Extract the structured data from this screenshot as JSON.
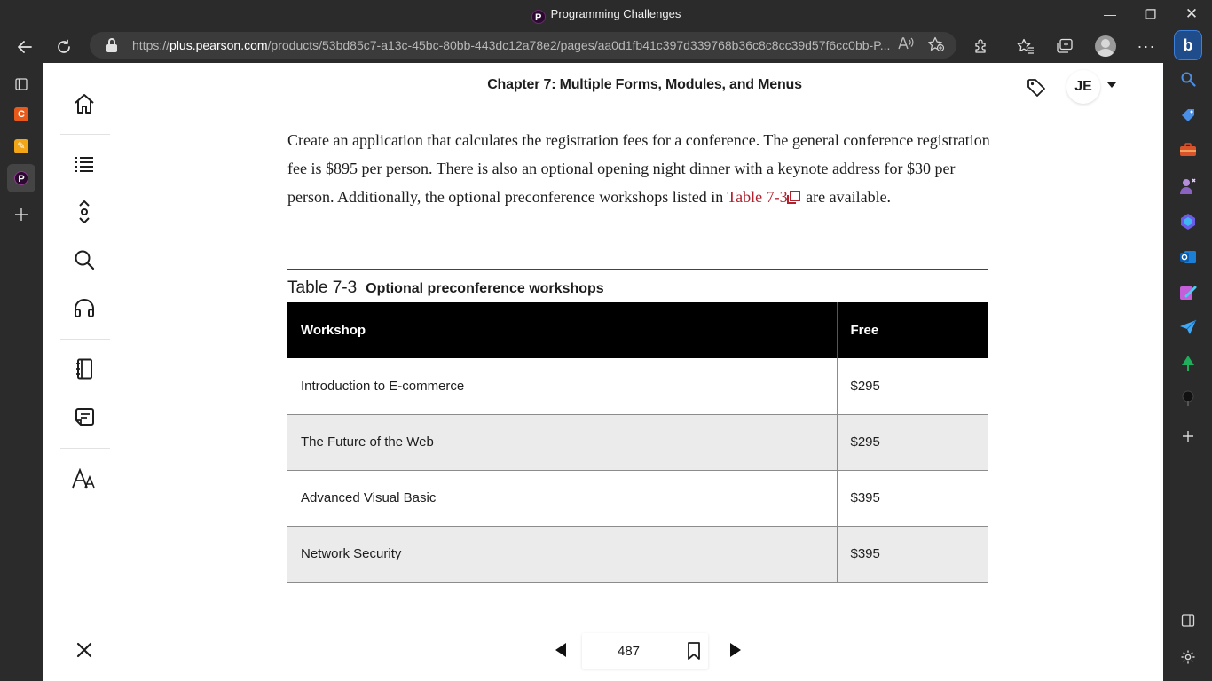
{
  "window": {
    "title": "Programming Challenges",
    "favicon_letter": "P",
    "minimize": "—",
    "restore": "❐",
    "close": "✕"
  },
  "address_bar": {
    "url_prefix": "https://",
    "url_host": "plus.pearson.com",
    "url_path": "/products/53bd85c7-a13c-45bc-80bb-443dc12a78e2/pages/aa0d1fb41c397d339768b36c8c8cc39d57f6cc0bb-P..."
  },
  "reader": {
    "chapter_title": "Chapter 7: Multiple Forms, Modules, and Menus",
    "user_initials": "JE",
    "paragraph_main": "Create an application that calculates the registration fees for a conference. The general conference registration fee is $895 per person. There is also an optional opening night dinner with a keynote address for $30 per person. Additionally, the optional preconference workshops listed in ",
    "paragraph_link": "Table 7-3",
    "paragraph_end": " are available.",
    "table_caption_number": "Table 7-3",
    "table_caption_title": "Optional preconference workshops",
    "table": {
      "headers": [
        "Workshop",
        "Free"
      ],
      "rows": [
        [
          "Introduction to E-commerce",
          "$295"
        ],
        [
          "The Future of the Web",
          "$295"
        ],
        [
          "Advanced Visual Basic",
          "$395"
        ],
        [
          "Network Security",
          "$395"
        ]
      ]
    },
    "page_number": "487"
  },
  "colors": {
    "link": "#b0202d",
    "table_header_bg": "#000000",
    "alt_row_bg": "#ebebeb"
  }
}
